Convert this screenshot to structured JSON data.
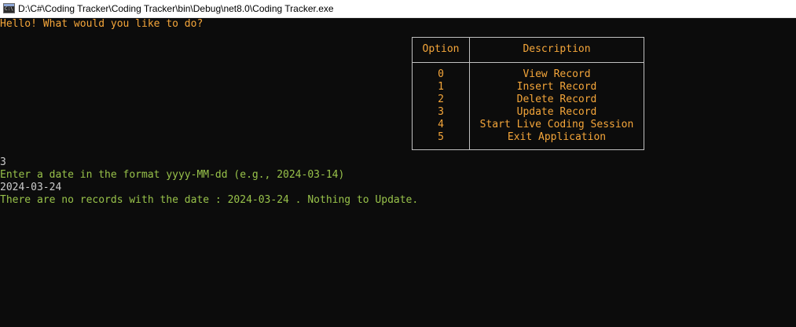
{
  "window": {
    "title": "D:\\C#\\Coding Tracker\\Coding Tracker\\bin\\Debug\\net8.0\\Coding Tracker.exe"
  },
  "console": {
    "greeting": "Hello! What would you like to do?",
    "menu": {
      "headers": {
        "option": "Option",
        "description": "Description"
      },
      "rows": [
        {
          "option": "0",
          "description": "View Record"
        },
        {
          "option": "1",
          "description": "Insert Record"
        },
        {
          "option": "2",
          "description": "Delete Record"
        },
        {
          "option": "3",
          "description": "Update Record"
        },
        {
          "option": "4",
          "description": "Start Live Coding Session"
        },
        {
          "option": "5",
          "description": "Exit Application"
        }
      ]
    },
    "user_choice": "3",
    "date_prompt": "Enter a date in the format yyyy-MM-dd (e.g., 2024-03-14)",
    "user_date": "2024-03-24",
    "result_message": "There are no records with the date : 2024-03-24 . Nothing to Update."
  },
  "colors": {
    "background": "#0c0c0c",
    "prompt_orange": "#f5a63a",
    "message_green": "#98c24a",
    "input_white": "#cccccc",
    "table_border": "#c0c0c0"
  }
}
